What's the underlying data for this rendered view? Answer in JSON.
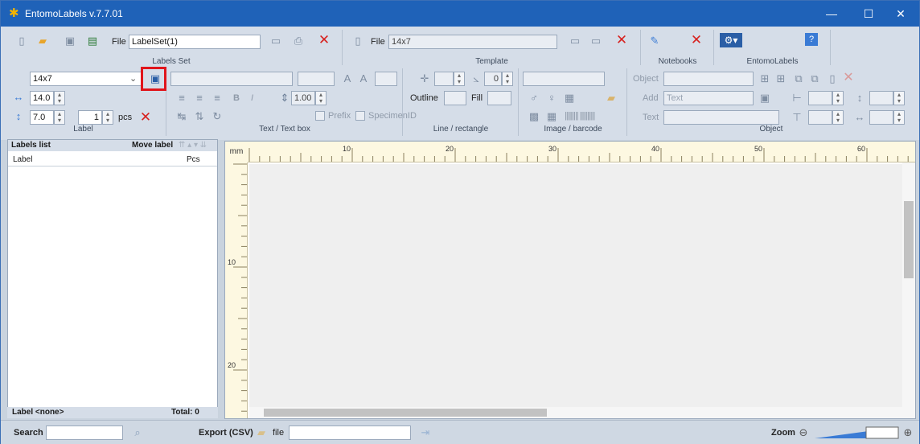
{
  "window": {
    "title": "EntomoLabels v.7.7.01",
    "controls": {
      "minimize": "—",
      "maximize": "☐",
      "close": "✕"
    }
  },
  "ribbon": {
    "labels_set": {
      "file_label": "File",
      "file_value": "LabelSet(1)",
      "group_label": "Labels Set"
    },
    "template": {
      "file_label": "File",
      "file_value": "14x7",
      "group_label": "Template"
    },
    "notebooks": {
      "group_label": "Notebooks"
    },
    "entomolabels": {
      "group_label": "EntomoLabels"
    },
    "label": {
      "template_select": "14x7",
      "width": "14.0",
      "height": "7.0",
      "copies": "1",
      "copies_unit": "pcs",
      "group_label": "Label"
    },
    "text_box": {
      "line_spacing": "1.00",
      "bold": "B",
      "italic": "I",
      "prefix": "Prefix",
      "specimen_id": "SpecimenID",
      "group_label": "Text / Text box"
    },
    "line_rectangle": {
      "angle": "0",
      "outline": "Outline",
      "fill": "Fill",
      "group_label": "Line / rectangle"
    },
    "image_barcode": {
      "group_label": "Image / barcode"
    },
    "object": {
      "object_label": "Object",
      "add_label": "Add",
      "add_value": "Text",
      "text_label": "Text",
      "group_label": "Object"
    }
  },
  "labels_list": {
    "title": "Labels list",
    "move_label": "Move label",
    "columns": [
      "Label",
      "Pcs"
    ],
    "footer_label": "Label <none>",
    "footer_total": "Total: 0"
  },
  "canvas": {
    "unit": "mm",
    "h_ticks": [
      "10",
      "20",
      "30",
      "40",
      "50",
      "60"
    ],
    "v_ticks": [
      "10",
      "20"
    ]
  },
  "status": {
    "search_label": "Search",
    "export_label": "Export (CSV)",
    "file_label": "file",
    "zoom_label": "Zoom"
  }
}
